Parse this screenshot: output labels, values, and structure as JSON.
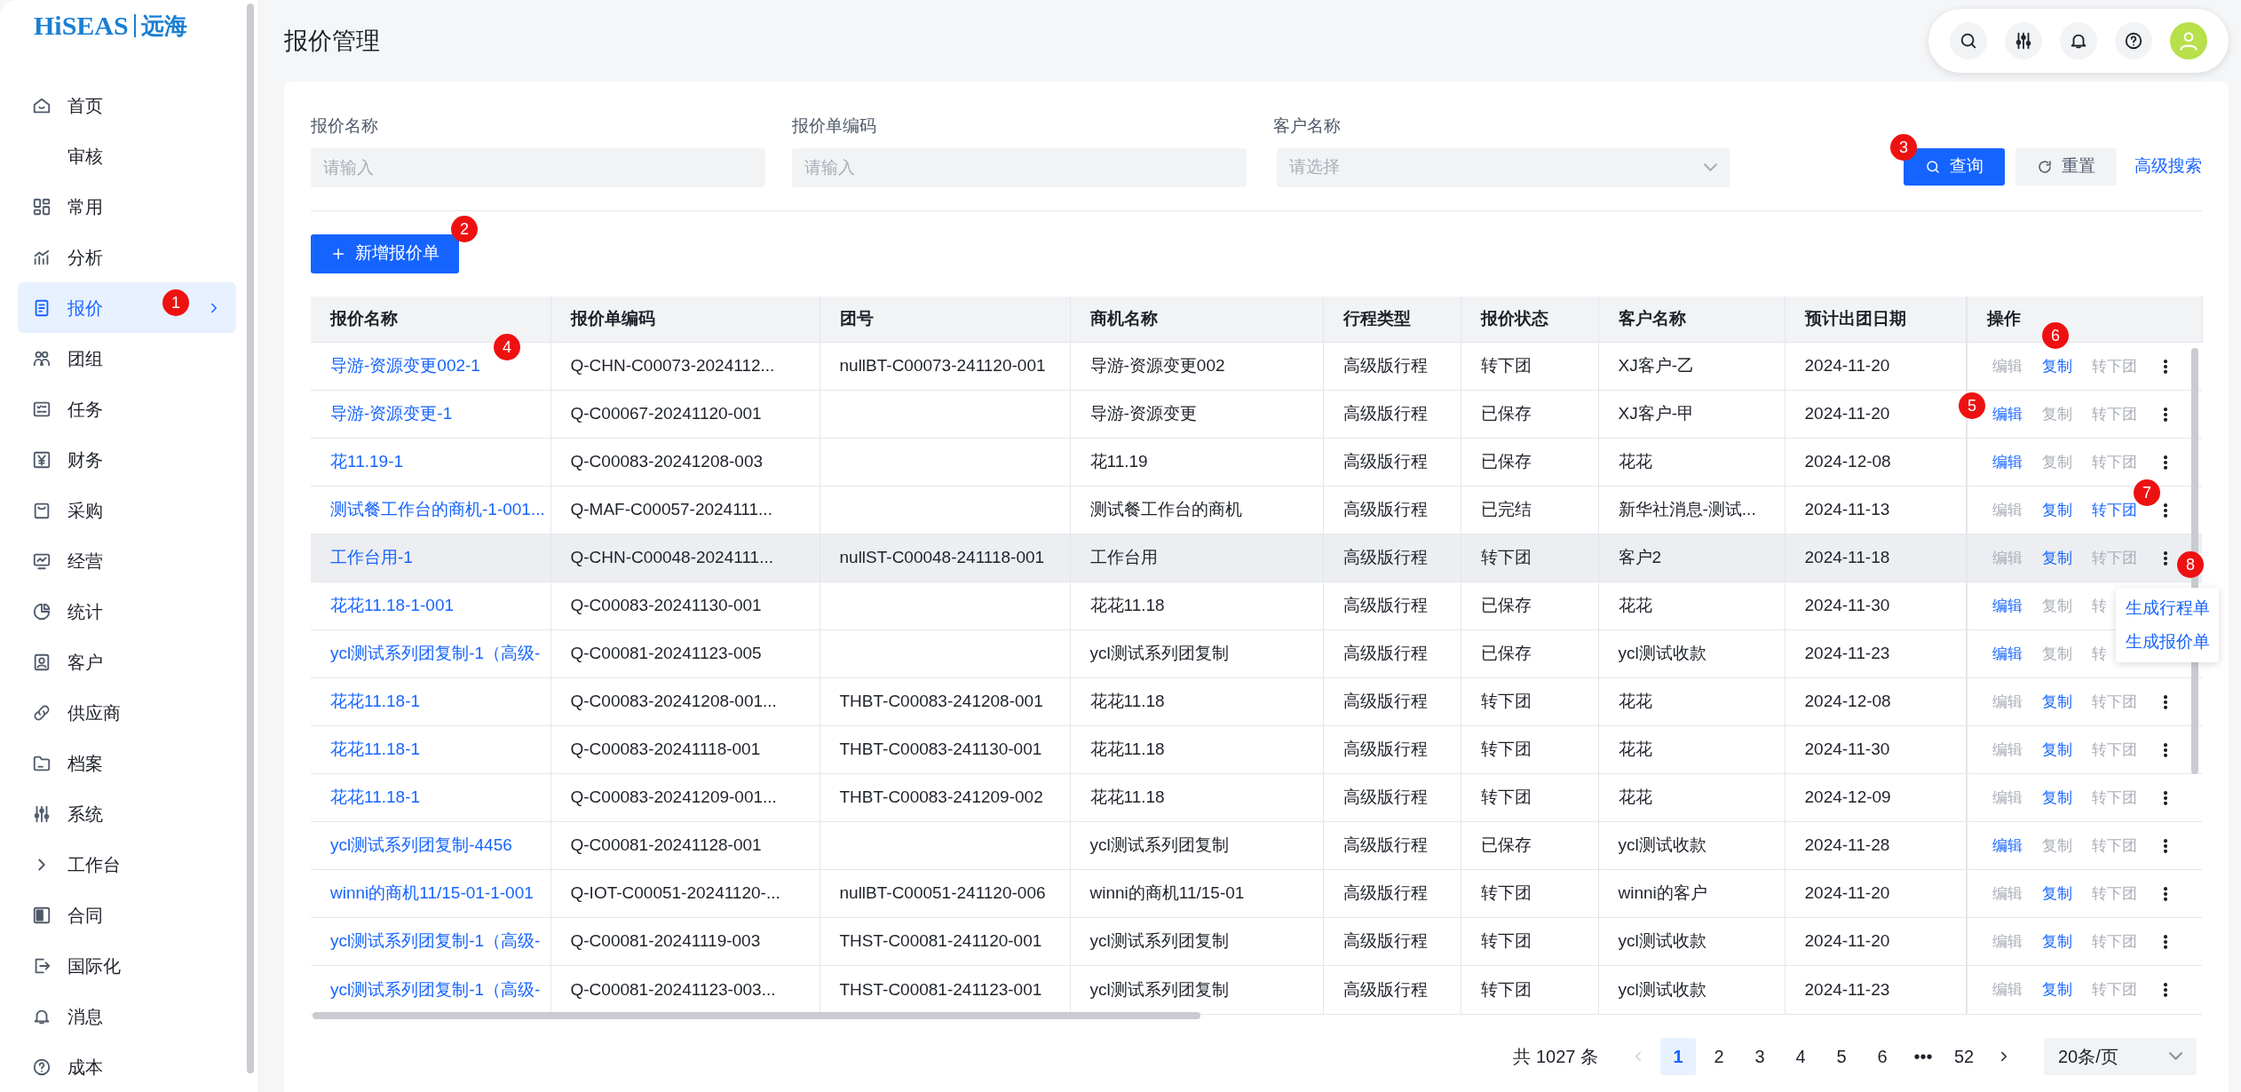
{
  "logo": {
    "brand": "HiSEAS",
    "cn": "远海"
  },
  "sidebar": {
    "items": [
      {
        "label": "首页",
        "selected": false
      },
      {
        "label": "审核",
        "selected": false
      },
      {
        "label": "常用",
        "selected": false
      },
      {
        "label": "分析",
        "selected": false
      },
      {
        "label": "报价",
        "selected": true
      },
      {
        "label": "团组",
        "selected": false
      },
      {
        "label": "任务",
        "selected": false
      },
      {
        "label": "财务",
        "selected": false
      },
      {
        "label": "采购",
        "selected": false
      },
      {
        "label": "经营",
        "selected": false
      },
      {
        "label": "统计",
        "selected": false
      },
      {
        "label": "客户",
        "selected": false
      },
      {
        "label": "供应商",
        "selected": false
      },
      {
        "label": "档案",
        "selected": false
      },
      {
        "label": "系统",
        "selected": false
      },
      {
        "label": "工作台",
        "selected": false
      },
      {
        "label": "合同",
        "selected": false
      },
      {
        "label": "国际化",
        "selected": false
      },
      {
        "label": "消息",
        "selected": false
      },
      {
        "label": "成本",
        "selected": false
      }
    ]
  },
  "page_title": "报价管理",
  "filters": [
    {
      "label": "报价名称",
      "placeholder": "请输入",
      "kind": "text"
    },
    {
      "label": "报价单编码",
      "placeholder": "请输入",
      "kind": "text"
    },
    {
      "label": "客户名称",
      "placeholder": "请选择",
      "kind": "select"
    }
  ],
  "search_actions": [
    {
      "label": "查询",
      "kind": "primary"
    },
    {
      "label": "重置",
      "kind": "secondary"
    },
    {
      "label": "高级搜索",
      "kind": "link"
    }
  ],
  "new_button": "新增报价单",
  "table": {
    "columns": [
      "报价名称",
      "报价单编码",
      "团号",
      "商机名称",
      "行程类型",
      "报价状态",
      "客户名称",
      "预计出团日期",
      "操作"
    ],
    "rows": [
      {
        "cells": [
          "导游-资源变更002-1",
          "Q-CHN-C00073-2024112...",
          "nullBT-C00073-241120-001",
          "导游-资源变更002",
          "高级版行程",
          "转下团",
          "XJ客户-乙",
          "2024-11-20"
        ],
        "hovered": false,
        "more_visible": true,
        "actions": [
          {
            "label": "编辑",
            "enabled": false
          },
          {
            "label": "复制",
            "enabled": true
          },
          {
            "label": "转下团",
            "enabled": false
          }
        ]
      },
      {
        "cells": [
          "导游-资源变更-1",
          "Q-C00067-20241120-001",
          "",
          "导游-资源变更",
          "高级版行程",
          "已保存",
          "XJ客户-甲",
          "2024-11-20"
        ],
        "hovered": false,
        "more_visible": true,
        "actions": [
          {
            "label": "编辑",
            "enabled": true
          },
          {
            "label": "复制",
            "enabled": false
          },
          {
            "label": "转下团",
            "enabled": false
          }
        ]
      },
      {
        "cells": [
          "花11.19-1",
          "Q-C00083-20241208-003",
          "",
          "花11.19",
          "高级版行程",
          "已保存",
          "花花",
          "2024-12-08"
        ],
        "hovered": false,
        "more_visible": true,
        "actions": [
          {
            "label": "编辑",
            "enabled": true
          },
          {
            "label": "复制",
            "enabled": false
          },
          {
            "label": "转下团",
            "enabled": false
          }
        ]
      },
      {
        "cells": [
          "测试餐工作台的商机-1-001...",
          "Q-MAF-C00057-2024111...",
          "",
          "测试餐工作台的商机",
          "高级版行程",
          "已完结",
          "新华社消息-测试...",
          "2024-11-13"
        ],
        "hovered": false,
        "more_visible": true,
        "actions": [
          {
            "label": "编辑",
            "enabled": false
          },
          {
            "label": "复制",
            "enabled": true
          },
          {
            "label": "转下团",
            "enabled": true
          }
        ]
      },
      {
        "cells": [
          "工作台用-1",
          "Q-CHN-C00048-2024111...",
          "nullST-C00048-241118-001",
          "工作台用",
          "高级版行程",
          "转下团",
          "客户2",
          "2024-11-18"
        ],
        "hovered": true,
        "more_visible": true,
        "actions": [
          {
            "label": "编辑",
            "enabled": false
          },
          {
            "label": "复制",
            "enabled": true
          },
          {
            "label": "转下团",
            "enabled": false
          }
        ]
      },
      {
        "cells": [
          "花花11.18-1-001",
          "Q-C00083-20241130-001",
          "",
          "花花11.18",
          "高级版行程",
          "已保存",
          "花花",
          "2024-11-30"
        ],
        "hovered": false,
        "more_visible": false,
        "actions": [
          {
            "label": "编辑",
            "enabled": true
          },
          {
            "label": "复制",
            "enabled": false
          },
          {
            "label": "转",
            "enabled": false
          }
        ]
      },
      {
        "cells": [
          "ycl测试系列团复制-1（高级-",
          "Q-C00081-20241123-005",
          "",
          "ycl测试系列团复制",
          "高级版行程",
          "已保存",
          "ycl测试收款",
          "2024-11-23"
        ],
        "hovered": false,
        "more_visible": false,
        "actions": [
          {
            "label": "编辑",
            "enabled": true
          },
          {
            "label": "复制",
            "enabled": false
          },
          {
            "label": "转",
            "enabled": false
          }
        ]
      },
      {
        "cells": [
          "花花11.18-1",
          "Q-C00083-20241208-001...",
          "THBT-C00083-241208-001",
          "花花11.18",
          "高级版行程",
          "转下团",
          "花花",
          "2024-12-08"
        ],
        "hovered": false,
        "more_visible": true,
        "actions": [
          {
            "label": "编辑",
            "enabled": false
          },
          {
            "label": "复制",
            "enabled": true
          },
          {
            "label": "转下团",
            "enabled": false
          }
        ]
      },
      {
        "cells": [
          "花花11.18-1",
          "Q-C00083-20241118-001",
          "THBT-C00083-241130-001",
          "花花11.18",
          "高级版行程",
          "转下团",
          "花花",
          "2024-11-30"
        ],
        "hovered": false,
        "more_visible": true,
        "actions": [
          {
            "label": "编辑",
            "enabled": false
          },
          {
            "label": "复制",
            "enabled": true
          },
          {
            "label": "转下团",
            "enabled": false
          }
        ]
      },
      {
        "cells": [
          "花花11.18-1",
          "Q-C00083-20241209-001...",
          "THBT-C00083-241209-002",
          "花花11.18",
          "高级版行程",
          "转下团",
          "花花",
          "2024-12-09"
        ],
        "hovered": false,
        "more_visible": true,
        "actions": [
          {
            "label": "编辑",
            "enabled": false
          },
          {
            "label": "复制",
            "enabled": true
          },
          {
            "label": "转下团",
            "enabled": false
          }
        ]
      },
      {
        "cells": [
          "ycl测试系列团复制-4456",
          "Q-C00081-20241128-001",
          "",
          "ycl测试系列团复制",
          "高级版行程",
          "已保存",
          "ycl测试收款",
          "2024-11-28"
        ],
        "hovered": false,
        "more_visible": true,
        "actions": [
          {
            "label": "编辑",
            "enabled": true
          },
          {
            "label": "复制",
            "enabled": false
          },
          {
            "label": "转下团",
            "enabled": false
          }
        ]
      },
      {
        "cells": [
          "winni的商机11/15-01-1-001",
          "Q-IOT-C00051-20241120-...",
          "nullBT-C00051-241120-006",
          "winni的商机11/15-01",
          "高级版行程",
          "转下团",
          "winni的客户",
          "2024-11-20"
        ],
        "hovered": false,
        "more_visible": true,
        "actions": [
          {
            "label": "编辑",
            "enabled": false
          },
          {
            "label": "复制",
            "enabled": true
          },
          {
            "label": "转下团",
            "enabled": false
          }
        ]
      },
      {
        "cells": [
          "ycl测试系列团复制-1（高级-",
          "Q-C00081-20241119-003",
          "THST-C00081-241120-001",
          "ycl测试系列团复制",
          "高级版行程",
          "转下团",
          "ycl测试收款",
          "2024-11-20"
        ],
        "hovered": false,
        "more_visible": true,
        "actions": [
          {
            "label": "编辑",
            "enabled": false
          },
          {
            "label": "复制",
            "enabled": true
          },
          {
            "label": "转下团",
            "enabled": false
          }
        ]
      },
      {
        "cells": [
          "ycl测试系列团复制-1（高级-",
          "Q-C00081-20241123-003...",
          "THST-C00081-241123-001",
          "ycl测试系列团复制",
          "高级版行程",
          "转下团",
          "ycl测试收款",
          "2024-11-23"
        ],
        "hovered": false,
        "more_visible": true,
        "actions": [
          {
            "label": "编辑",
            "enabled": false
          },
          {
            "label": "复制",
            "enabled": true
          },
          {
            "label": "转下团",
            "enabled": false
          }
        ]
      }
    ]
  },
  "dropdown_menu": {
    "items": [
      "生成行程单",
      "生成报价单"
    ]
  },
  "pagination": {
    "total": "共 1027 条",
    "pages": [
      {
        "label": "1",
        "selected": true
      },
      {
        "label": "2",
        "selected": false
      },
      {
        "label": "3",
        "selected": false
      },
      {
        "label": "4",
        "selected": false
      },
      {
        "label": "5",
        "selected": false
      },
      {
        "label": "6",
        "selected": false
      },
      {
        "label": "•••",
        "selected": false
      },
      {
        "label": "52",
        "selected": false
      }
    ],
    "page_size": "20条/页"
  },
  "annotations": [
    "1",
    "2",
    "3",
    "4",
    "5",
    "6",
    "7",
    "8"
  ]
}
